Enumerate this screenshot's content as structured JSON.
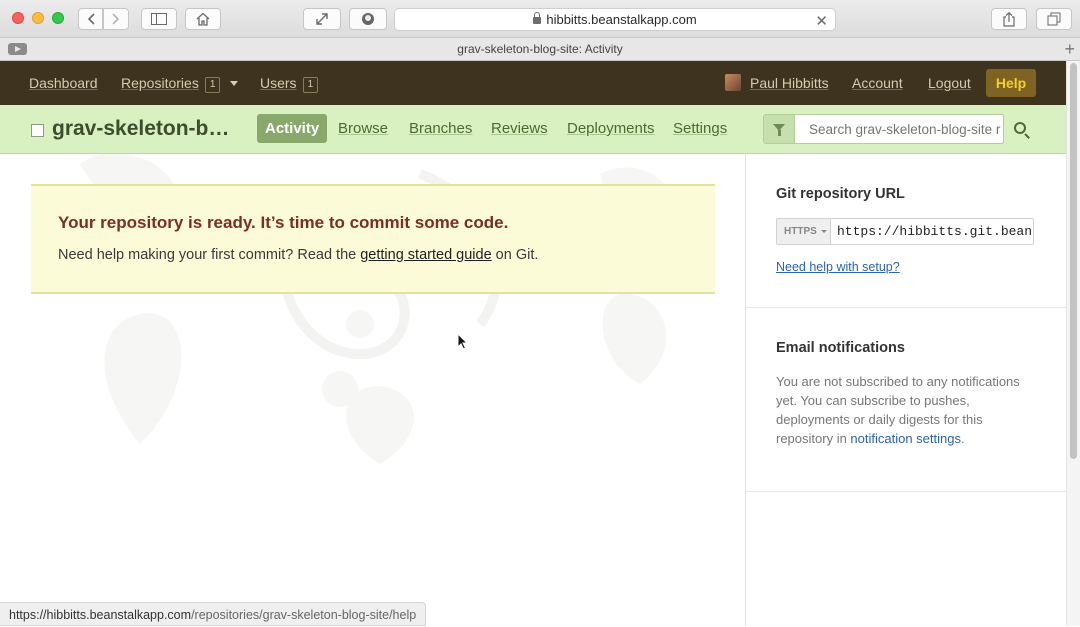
{
  "browser": {
    "address": "hibbitts.beanstalkapp.com",
    "tab_title": "grav-skeleton-blog-site: Activity"
  },
  "topnav": {
    "dashboard": "Dashboard",
    "repositories": "Repositories",
    "repositories_count": "1",
    "users": "Users",
    "users_count": "1",
    "user_name": "Paul Hibbitts",
    "account": "Account",
    "logout": "Logout",
    "help": "Help"
  },
  "repo": {
    "name": "grav-skeleton-b…",
    "tabs": [
      "Activity",
      "Browse",
      "Branches",
      "Reviews",
      "Deployments",
      "Settings"
    ],
    "search_placeholder": "Search grav-skeleton-blog-site r"
  },
  "notice": {
    "title": "Your repository is ready. It’s time to commit some code.",
    "text_before": "Need help making your first commit? Read the ",
    "link": "getting started guide",
    "text_after": " on Git."
  },
  "sidebar": {
    "git_heading": "Git repository URL",
    "protocol": "HTTPS",
    "url": "https://hibbitts.git.beanst",
    "setup_link": "Need help with setup?",
    "email_heading": "Email notifications",
    "email_text": "You are not subscribed to any notifications yet. You can subscribe to pushes, deployments or daily digests for this repository in ",
    "email_link": "notification settings",
    "email_end": "."
  },
  "status_bar": {
    "host": "https://hibbitts.beanstalkapp.com",
    "path": "/repositories/grav-skeleton-blog-site/help"
  }
}
